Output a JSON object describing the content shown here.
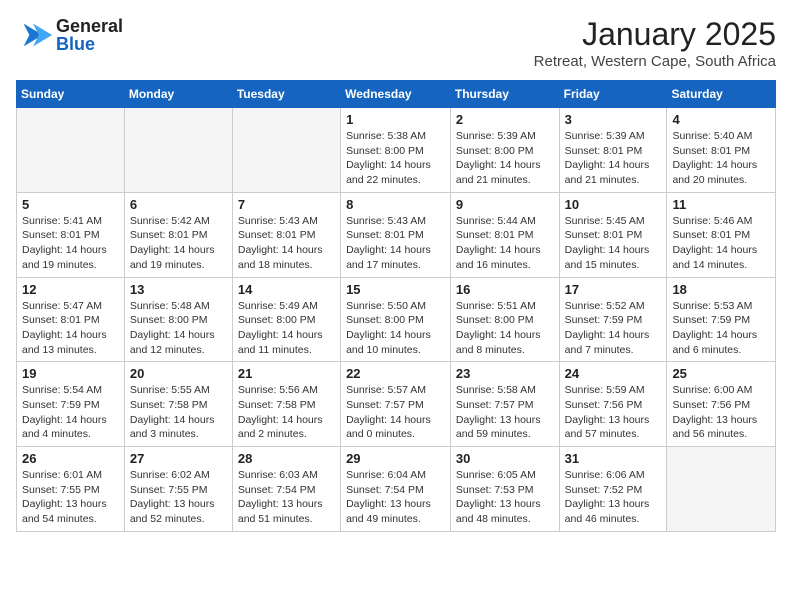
{
  "header": {
    "logo_general": "General",
    "logo_blue": "Blue",
    "month_title": "January 2025",
    "subtitle": "Retreat, Western Cape, South Africa"
  },
  "weekdays": [
    "Sunday",
    "Monday",
    "Tuesday",
    "Wednesday",
    "Thursday",
    "Friday",
    "Saturday"
  ],
  "weeks": [
    [
      {
        "day": "",
        "info": ""
      },
      {
        "day": "",
        "info": ""
      },
      {
        "day": "",
        "info": ""
      },
      {
        "day": "1",
        "info": "Sunrise: 5:38 AM\nSunset: 8:00 PM\nDaylight: 14 hours\nand 22 minutes."
      },
      {
        "day": "2",
        "info": "Sunrise: 5:39 AM\nSunset: 8:00 PM\nDaylight: 14 hours\nand 21 minutes."
      },
      {
        "day": "3",
        "info": "Sunrise: 5:39 AM\nSunset: 8:01 PM\nDaylight: 14 hours\nand 21 minutes."
      },
      {
        "day": "4",
        "info": "Sunrise: 5:40 AM\nSunset: 8:01 PM\nDaylight: 14 hours\nand 20 minutes."
      }
    ],
    [
      {
        "day": "5",
        "info": "Sunrise: 5:41 AM\nSunset: 8:01 PM\nDaylight: 14 hours\nand 19 minutes."
      },
      {
        "day": "6",
        "info": "Sunrise: 5:42 AM\nSunset: 8:01 PM\nDaylight: 14 hours\nand 19 minutes."
      },
      {
        "day": "7",
        "info": "Sunrise: 5:43 AM\nSunset: 8:01 PM\nDaylight: 14 hours\nand 18 minutes."
      },
      {
        "day": "8",
        "info": "Sunrise: 5:43 AM\nSunset: 8:01 PM\nDaylight: 14 hours\nand 17 minutes."
      },
      {
        "day": "9",
        "info": "Sunrise: 5:44 AM\nSunset: 8:01 PM\nDaylight: 14 hours\nand 16 minutes."
      },
      {
        "day": "10",
        "info": "Sunrise: 5:45 AM\nSunset: 8:01 PM\nDaylight: 14 hours\nand 15 minutes."
      },
      {
        "day": "11",
        "info": "Sunrise: 5:46 AM\nSunset: 8:01 PM\nDaylight: 14 hours\nand 14 minutes."
      }
    ],
    [
      {
        "day": "12",
        "info": "Sunrise: 5:47 AM\nSunset: 8:01 PM\nDaylight: 14 hours\nand 13 minutes."
      },
      {
        "day": "13",
        "info": "Sunrise: 5:48 AM\nSunset: 8:00 PM\nDaylight: 14 hours\nand 12 minutes."
      },
      {
        "day": "14",
        "info": "Sunrise: 5:49 AM\nSunset: 8:00 PM\nDaylight: 14 hours\nand 11 minutes."
      },
      {
        "day": "15",
        "info": "Sunrise: 5:50 AM\nSunset: 8:00 PM\nDaylight: 14 hours\nand 10 minutes."
      },
      {
        "day": "16",
        "info": "Sunrise: 5:51 AM\nSunset: 8:00 PM\nDaylight: 14 hours\nand 8 minutes."
      },
      {
        "day": "17",
        "info": "Sunrise: 5:52 AM\nSunset: 7:59 PM\nDaylight: 14 hours\nand 7 minutes."
      },
      {
        "day": "18",
        "info": "Sunrise: 5:53 AM\nSunset: 7:59 PM\nDaylight: 14 hours\nand 6 minutes."
      }
    ],
    [
      {
        "day": "19",
        "info": "Sunrise: 5:54 AM\nSunset: 7:59 PM\nDaylight: 14 hours\nand 4 minutes."
      },
      {
        "day": "20",
        "info": "Sunrise: 5:55 AM\nSunset: 7:58 PM\nDaylight: 14 hours\nand 3 minutes."
      },
      {
        "day": "21",
        "info": "Sunrise: 5:56 AM\nSunset: 7:58 PM\nDaylight: 14 hours\nand 2 minutes."
      },
      {
        "day": "22",
        "info": "Sunrise: 5:57 AM\nSunset: 7:57 PM\nDaylight: 14 hours\nand 0 minutes."
      },
      {
        "day": "23",
        "info": "Sunrise: 5:58 AM\nSunset: 7:57 PM\nDaylight: 13 hours\nand 59 minutes."
      },
      {
        "day": "24",
        "info": "Sunrise: 5:59 AM\nSunset: 7:56 PM\nDaylight: 13 hours\nand 57 minutes."
      },
      {
        "day": "25",
        "info": "Sunrise: 6:00 AM\nSunset: 7:56 PM\nDaylight: 13 hours\nand 56 minutes."
      }
    ],
    [
      {
        "day": "26",
        "info": "Sunrise: 6:01 AM\nSunset: 7:55 PM\nDaylight: 13 hours\nand 54 minutes."
      },
      {
        "day": "27",
        "info": "Sunrise: 6:02 AM\nSunset: 7:55 PM\nDaylight: 13 hours\nand 52 minutes."
      },
      {
        "day": "28",
        "info": "Sunrise: 6:03 AM\nSunset: 7:54 PM\nDaylight: 13 hours\nand 51 minutes."
      },
      {
        "day": "29",
        "info": "Sunrise: 6:04 AM\nSunset: 7:54 PM\nDaylight: 13 hours\nand 49 minutes."
      },
      {
        "day": "30",
        "info": "Sunrise: 6:05 AM\nSunset: 7:53 PM\nDaylight: 13 hours\nand 48 minutes."
      },
      {
        "day": "31",
        "info": "Sunrise: 6:06 AM\nSunset: 7:52 PM\nDaylight: 13 hours\nand 46 minutes."
      },
      {
        "day": "",
        "info": ""
      }
    ]
  ]
}
